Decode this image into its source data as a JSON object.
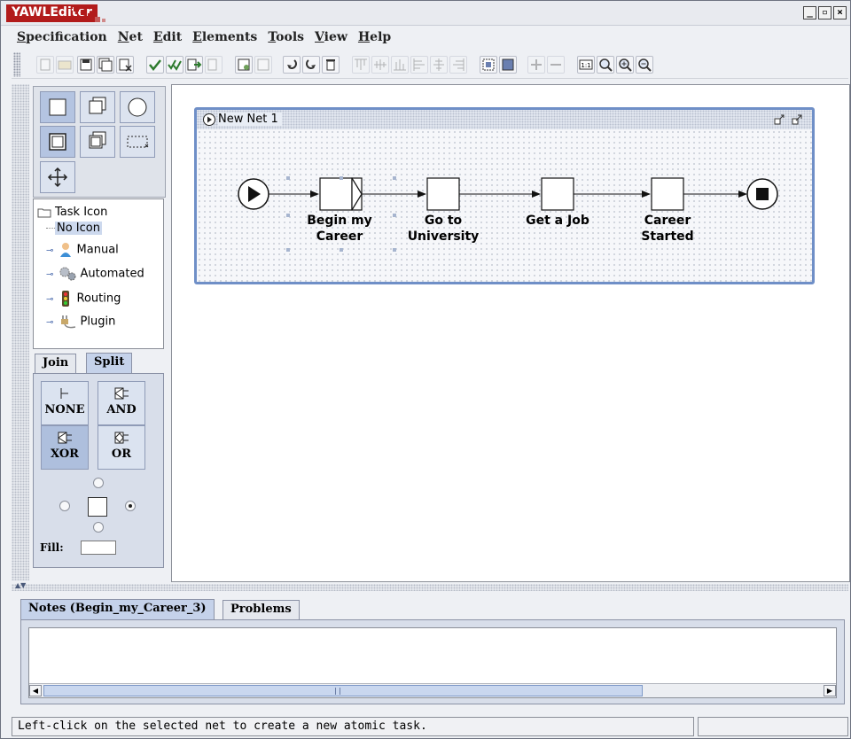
{
  "window": {
    "title": "YAWLEditor",
    "controls": [
      "_",
      "▫",
      "×"
    ]
  },
  "menu": [
    {
      "label": "Specification"
    },
    {
      "label": "Net"
    },
    {
      "label": "Edit"
    },
    {
      "label": "Elements"
    },
    {
      "label": "Tools"
    },
    {
      "label": "View"
    },
    {
      "label": "Help"
    }
  ],
  "tree": {
    "root": "Task Icon",
    "items": [
      {
        "label": "No Icon",
        "selected": true
      },
      {
        "label": "Manual"
      },
      {
        "label": "Automated"
      },
      {
        "label": "Routing"
      },
      {
        "label": "Plugin"
      }
    ]
  },
  "decorator_tabs": {
    "join": "Join",
    "split": "Split",
    "active": "Split"
  },
  "split_buttons": [
    {
      "label": "NONE",
      "pressed": false
    },
    {
      "label": "AND",
      "pressed": false
    },
    {
      "label": "XOR",
      "pressed": true
    },
    {
      "label": "OR",
      "pressed": false
    }
  ],
  "fill": {
    "label": "Fill:"
  },
  "net": {
    "title": "New Net 1",
    "tasks": [
      {
        "label": "Begin my\nCareer",
        "selected": true,
        "has_split_decorator": true
      },
      {
        "label": "Go to\nUniversity"
      },
      {
        "label": "Get a Job"
      },
      {
        "label": "Career\nStarted"
      }
    ]
  },
  "bottom_tabs": [
    {
      "label": "Notes (Begin_my_Career_3)",
      "active": true
    },
    {
      "label": "Problems",
      "active": false
    }
  ],
  "status": {
    "message": "Left-click on the selected net to create a new atomic task."
  },
  "colors": {
    "title_red": "#b21b1b",
    "net_frame": "#6f8fc7",
    "active_tab": "#c5d2ea",
    "pressed_button": "#aebfdd"
  }
}
